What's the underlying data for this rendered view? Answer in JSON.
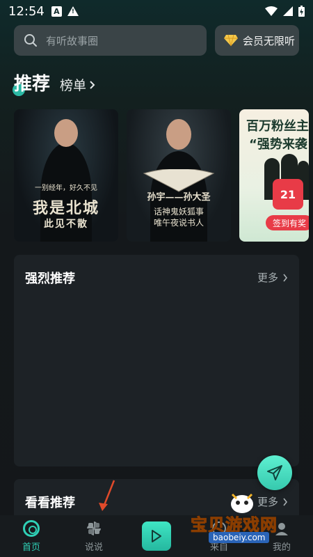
{
  "status_bar": {
    "time": "12:54",
    "icon_a": "A",
    "warn": "!"
  },
  "header": {
    "search_placeholder": "有听故事圈",
    "vip_label": "会员无限听"
  },
  "tabs": {
    "active": "推荐",
    "rank": "榜单"
  },
  "banners": [
    {
      "subtitle": "一别经年，好久不见",
      "title": "我是北城",
      "line": "此见不散"
    },
    {
      "title": "孙宇——孙大圣",
      "line1": "话神鬼妖狐事",
      "line2": "唯午夜说书人"
    },
    {
      "title1": "百万粉丝主",
      "title2": "“强势来袭",
      "calendar": "21",
      "button": "签到有奖"
    }
  ],
  "cards": [
    {
      "title": "强烈推荐",
      "more": "更多"
    },
    {
      "title": "看看推荐",
      "more": "更多"
    }
  ],
  "bottom_nav": [
    {
      "label": "首页",
      "active": true,
      "icon": "home-icon"
    },
    {
      "label": "说说",
      "active": false,
      "icon": "pinwheel-icon"
    },
    {
      "label": "",
      "active": false,
      "icon": "play-icon"
    },
    {
      "label": "来自",
      "active": false,
      "icon": "discover-icon"
    },
    {
      "label": "我的",
      "active": false,
      "icon": "profile-icon"
    }
  ],
  "watermark": {
    "text": "宝贝游戏网",
    "url": "baobeiy.com"
  },
  "colors": {
    "accent": "#2fd0b6",
    "card_bg": "#1d2226",
    "arrow": "#e04a2a"
  }
}
